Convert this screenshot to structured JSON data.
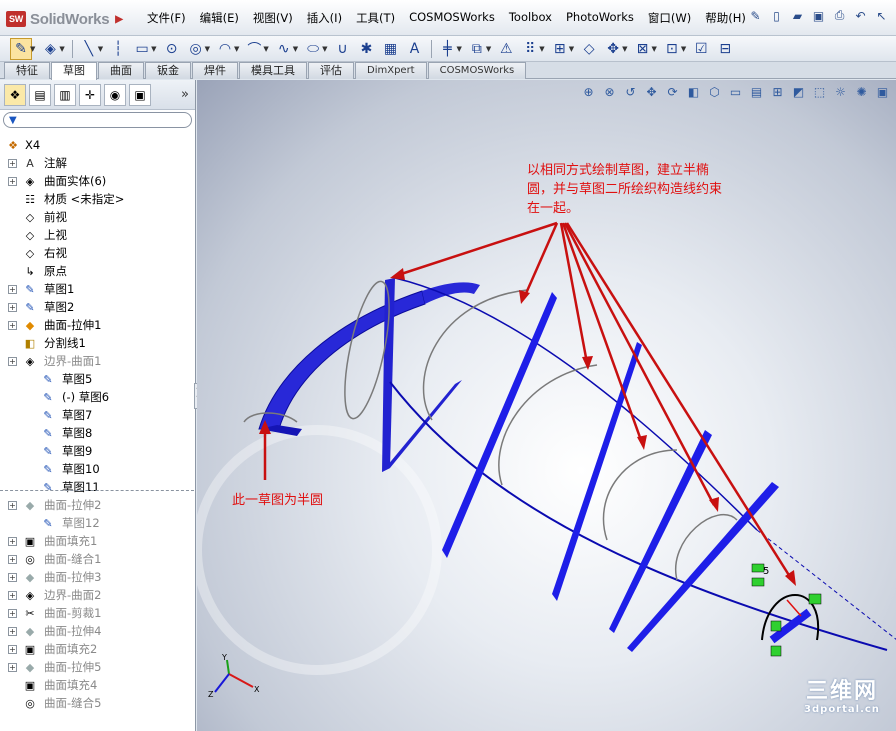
{
  "app": {
    "name": "SolidWorks"
  },
  "menu": [
    "文件(F)",
    "编辑(E)",
    "视图(V)",
    "插入(I)",
    "工具(T)",
    "COSMOSWorks",
    "Toolbox",
    "PhotoWorks",
    "窗口(W)",
    "帮助(H)"
  ],
  "tabs": [
    "特征",
    "草图",
    "曲面",
    "钣金",
    "焊件",
    "模具工具",
    "评估",
    "DimXpert",
    "COSMOSWorks"
  ],
  "active_tab": "草图",
  "tree": {
    "root": "X4",
    "items": [
      {
        "label": "注解",
        "icon": "annotation-icon"
      },
      {
        "label": "曲面实体(6)",
        "icon": "surface-body-icon"
      },
      {
        "label": "材质 <未指定>",
        "icon": "material-icon"
      },
      {
        "label": "前视",
        "icon": "plane-icon"
      },
      {
        "label": "上视",
        "icon": "plane-icon"
      },
      {
        "label": "右视",
        "icon": "plane-icon"
      },
      {
        "label": "原点",
        "icon": "origin-icon"
      },
      {
        "label": "草图1",
        "icon": "sketch-icon"
      },
      {
        "label": "草图2",
        "icon": "sketch-icon"
      },
      {
        "label": "曲面-拉伸1",
        "icon": "extrude-icon"
      },
      {
        "label": "分割线1",
        "icon": "split-line-icon"
      },
      {
        "label": "边界-曲面1",
        "icon": "boundary-icon"
      },
      {
        "label": "草图5",
        "icon": "sketch-icon"
      },
      {
        "label": "(-) 草图6",
        "icon": "sketch-icon"
      },
      {
        "label": "草图7",
        "icon": "sketch-icon"
      },
      {
        "label": "草图8",
        "icon": "sketch-icon"
      },
      {
        "label": "草图9",
        "icon": "sketch-icon"
      },
      {
        "label": "草图10",
        "icon": "sketch-icon"
      },
      {
        "label": "草图11",
        "icon": "sketch-icon"
      },
      {
        "label": "曲面-拉伸2",
        "icon": "extrude-icon"
      },
      {
        "label": "草图12",
        "icon": "sketch-icon"
      },
      {
        "label": "曲面填充1",
        "icon": "fill-icon"
      },
      {
        "label": "曲面-缝合1",
        "icon": "knit-icon"
      },
      {
        "label": "曲面-拉伸3",
        "icon": "extrude-icon"
      },
      {
        "label": "边界-曲面2",
        "icon": "boundary-icon"
      },
      {
        "label": "曲面-剪裁1",
        "icon": "trim-icon"
      },
      {
        "label": "曲面-拉伸4",
        "icon": "extrude-icon"
      },
      {
        "label": "曲面填充2",
        "icon": "fill-icon"
      },
      {
        "label": "曲面-拉伸5",
        "icon": "extrude-icon"
      },
      {
        "label": "曲面填充4",
        "icon": "fill-icon"
      },
      {
        "label": "曲面-缝合5",
        "icon": "knit-icon"
      }
    ]
  },
  "annotations": {
    "top": "以相同方式绘制草图，建立半椭圆，并与草图二所绘织构造线约束在一起。",
    "left": "此一草图为半圆"
  },
  "dimension_label": "5",
  "axes": {
    "x": "X",
    "y": "Y",
    "z": "Z"
  },
  "watermark": {
    "big": "三维网",
    "small": "3dportal.cn"
  },
  "colors": {
    "accent": "#1a1aff",
    "annotation": "#e01010",
    "sketch_green": "#2fd02f"
  }
}
